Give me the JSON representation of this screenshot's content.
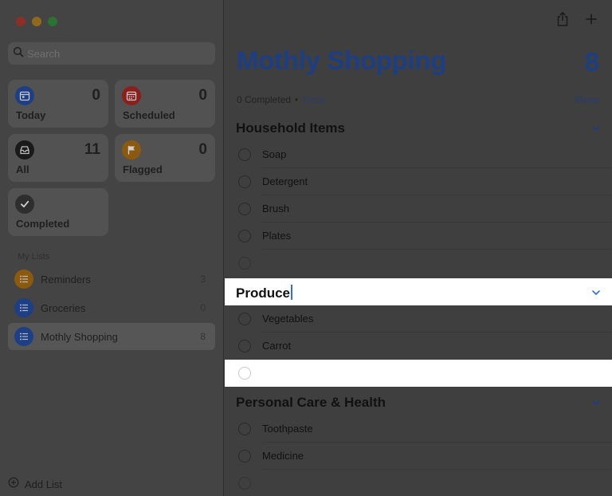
{
  "colors": {
    "accent": "#1c3f84",
    "traffic_red": "#8e2f27",
    "traffic_yellow": "#8f6a1d",
    "traffic_green": "#2a7331",
    "today": "#1d3f86",
    "scheduled": "#8b1f1c",
    "all": "#1a1a1a",
    "flagged": "#8b5a0e",
    "completed": "#2e2e2e",
    "reminders": "#8b5a0e",
    "groceries": "#1d3f86",
    "mothly": "#1d3f86"
  },
  "search": {
    "placeholder": "Search",
    "icon": "search-icon"
  },
  "smart_lists": [
    {
      "label": "Today",
      "count": "0",
      "icon": "calendar-today-icon"
    },
    {
      "label": "Scheduled",
      "count": "0",
      "icon": "calendar-icon"
    },
    {
      "label": "All",
      "count": "11",
      "icon": "tray-icon"
    },
    {
      "label": "Flagged",
      "count": "0",
      "icon": "flag-icon"
    },
    {
      "label": "Completed",
      "icon": "checkmark-icon"
    }
  ],
  "my_lists": {
    "heading": "My Lists",
    "items": [
      {
        "name": "Reminders",
        "count": "3",
        "icon": "list-bullet-icon"
      },
      {
        "name": "Groceries",
        "count": "0",
        "icon": "list-bullet-icon"
      },
      {
        "name": "Mothly Shopping",
        "count": "8",
        "icon": "list-bullet-icon",
        "selected": true
      }
    ]
  },
  "add_list_label": "Add List",
  "main": {
    "title": "Mothly Shopping",
    "count": "8",
    "completed_text": "0 Completed",
    "separator": "•",
    "clear_label": "Clear",
    "show_label": "Show",
    "groups": [
      {
        "title": "Household Items",
        "items": [
          "Soap",
          "Detergent",
          "Brush",
          "Plates",
          ""
        ]
      },
      {
        "title": "Produce",
        "items": [
          "Vegetables",
          "Carrot",
          ""
        ]
      },
      {
        "title": "Personal Care & Health",
        "items": [
          "Toothpaste",
          "Medicine",
          ""
        ]
      }
    ]
  }
}
